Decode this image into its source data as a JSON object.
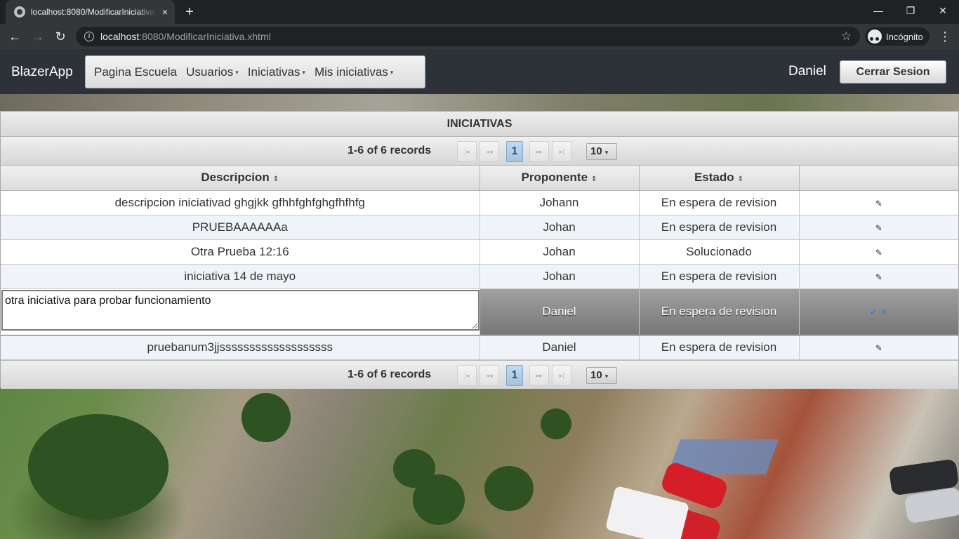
{
  "browser": {
    "tab_title": "localhost:8080/ModificarIniciativa.xhtml",
    "tab_close": "×",
    "new_tab": "+",
    "url_host": "localhost",
    "url_rest": ":8080/ModificarIniciativa.xhtml",
    "profile_label": "Incógnito",
    "back_glyph": "←",
    "forward_glyph": "→",
    "reload_glyph": "↻",
    "minimize_glyph": "—",
    "restore_glyph": "❐",
    "close_glyph": "✕",
    "star_glyph": "☆",
    "menu_glyph": "⋮"
  },
  "navbar": {
    "brand": "BlazerApp",
    "menu": [
      {
        "label": "Pagina Escuela",
        "has_dropdown": false
      },
      {
        "label": "Usuarios",
        "has_dropdown": true
      },
      {
        "label": "Iniciativas",
        "has_dropdown": true
      },
      {
        "label": "Mis iniciativas",
        "has_dropdown": true
      }
    ],
    "caret": "▾",
    "user": "Daniel",
    "logout": "Cerrar Sesion"
  },
  "table": {
    "title": "INICIATIVAS",
    "paginator": {
      "records_text": "1-6 of 6 records",
      "current_page": "1",
      "first": "|◂",
      "prev": "◂◂",
      "next": "▸▸",
      "last": "▸|",
      "rows_per_page": "10",
      "rpp_caret": "▾"
    },
    "columns": [
      "Descripcion",
      "Proponente",
      "Estado",
      ""
    ],
    "sort_glyph": "⇕",
    "edit_glyph": "✎",
    "save_glyph": "✔",
    "cancel_glyph": "✕",
    "rows": [
      {
        "descripcion": "descripcion iniciativad ghgjkk gfhhfghfghgfhfhfg",
        "proponente": "Johann",
        "estado": "En espera de revision"
      },
      {
        "descripcion": "PRUEBAAAAAAa",
        "proponente": "Johan",
        "estado": "En espera de revision"
      },
      {
        "descripcion": "Otra Prueba 12:16",
        "proponente": "Johan",
        "estado": "Solucionado"
      },
      {
        "descripcion": "iniciativa 14 de mayo",
        "proponente": "Johan",
        "estado": "En espera de revision"
      },
      {
        "descripcion": "otra iniciativa para probar funcionamiento",
        "proponente": "Daniel",
        "estado": "En espera de revision",
        "editing": true
      },
      {
        "descripcion": "pruebanum3jjsssssssssssssssssss",
        "proponente": "Daniel",
        "estado": "En espera de revision"
      }
    ]
  }
}
